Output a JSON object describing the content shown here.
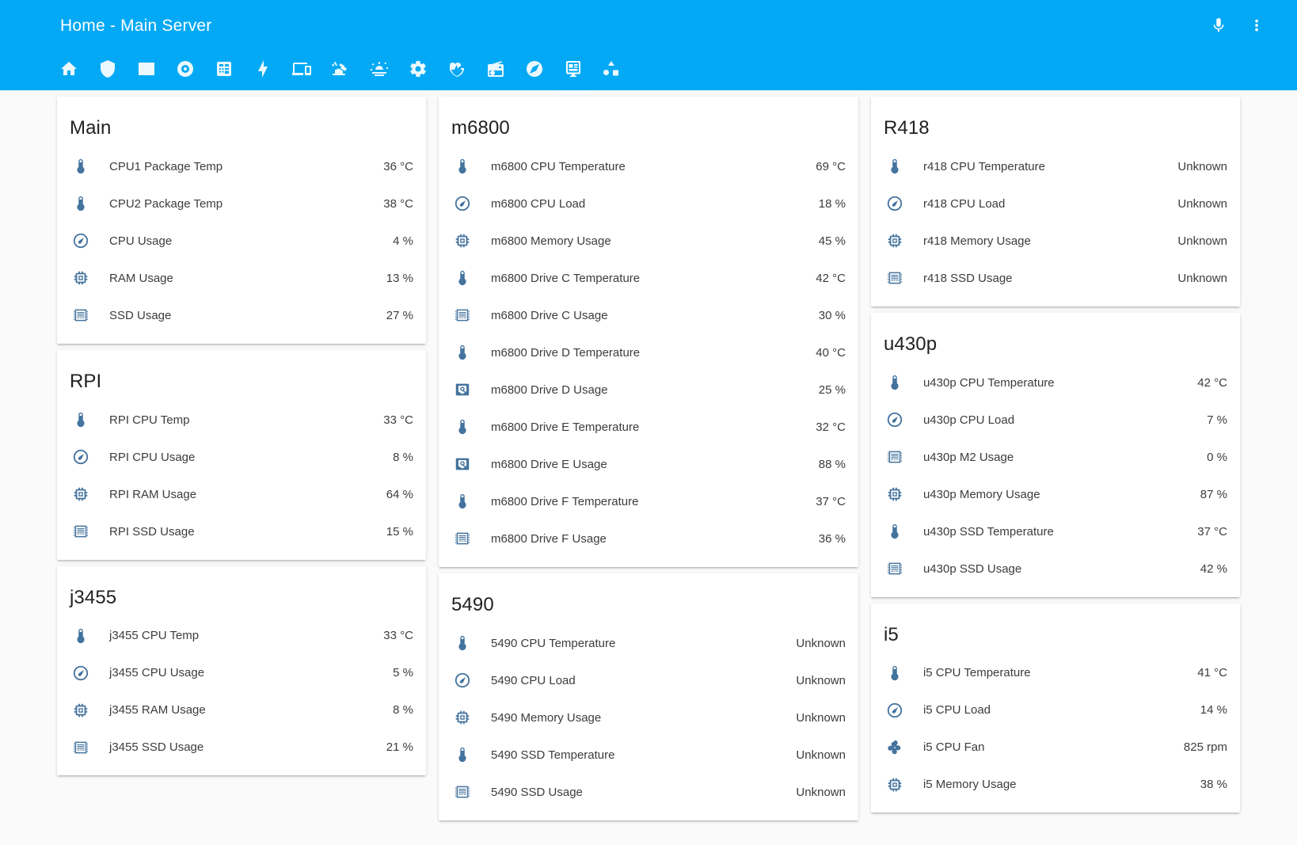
{
  "header": {
    "title": "Home - Main Server",
    "actions": [
      {
        "name": "microphone-icon",
        "label": "Assist"
      },
      {
        "name": "overflow-menu-icon",
        "label": "Menu"
      }
    ]
  },
  "tabs": [
    {
      "icon": "home-icon",
      "label": "Home",
      "active": false
    },
    {
      "icon": "shield-icon",
      "label": "Security",
      "active": false
    },
    {
      "icon": "square-icon",
      "label": "Rooms",
      "active": false
    },
    {
      "icon": "disc-icon",
      "label": "Vacuum",
      "active": false
    },
    {
      "icon": "calculator-icon",
      "label": "Meters",
      "active": false
    },
    {
      "icon": "lightning-icon",
      "label": "Energy",
      "active": false
    },
    {
      "icon": "devices-icon",
      "label": "Devices",
      "active": false
    },
    {
      "icon": "cctv-icon",
      "label": "Cameras",
      "active": false
    },
    {
      "icon": "weather-sunset-icon",
      "label": "Weather",
      "active": false
    },
    {
      "icon": "gear-icon",
      "label": "Settings",
      "active": false
    },
    {
      "icon": "heart-pulse-icon",
      "label": "Health",
      "active": false
    },
    {
      "icon": "radio-icon",
      "label": "Media",
      "active": false
    },
    {
      "icon": "compass-icon",
      "label": "Explore",
      "active": false
    },
    {
      "icon": "monitor-dashboard-icon",
      "label": "System",
      "active": true
    },
    {
      "icon": "shapes-icon",
      "label": "Misc",
      "active": false
    }
  ],
  "colors": {
    "accent": "#03a9f4",
    "icon": "#44739e",
    "text": "#3c3c3c",
    "title": "#212121",
    "card_bg": "#ffffff",
    "page_bg": "#fafafa"
  },
  "columns": [
    {
      "cards": [
        {
          "title": "Main",
          "rows": [
            {
              "icon": "thermometer-icon",
              "name": "CPU1 Package Temp",
              "value": "36 °C"
            },
            {
              "icon": "thermometer-icon",
              "name": "CPU2 Package Temp",
              "value": "38 °C"
            },
            {
              "icon": "gauge-icon",
              "name": "CPU Usage",
              "value": "4 %"
            },
            {
              "icon": "memory-icon",
              "name": "RAM Usage",
              "value": "13 %"
            },
            {
              "icon": "ssd-icon",
              "name": "SSD Usage",
              "value": "27 %"
            }
          ]
        },
        {
          "title": "RPI",
          "rows": [
            {
              "icon": "thermometer-icon",
              "name": "RPI CPU Temp",
              "value": "33 °C"
            },
            {
              "icon": "gauge-icon",
              "name": "RPI CPU Usage",
              "value": "8 %"
            },
            {
              "icon": "memory-icon",
              "name": "RPI RAM Usage",
              "value": "64 %"
            },
            {
              "icon": "ssd-icon",
              "name": "RPI SSD Usage",
              "value": "15 %"
            }
          ]
        },
        {
          "title": "j3455",
          "rows": [
            {
              "icon": "thermometer-icon",
              "name": "j3455 CPU Temp",
              "value": "33 °C"
            },
            {
              "icon": "gauge-icon",
              "name": "j3455 CPU Usage",
              "value": "5 %"
            },
            {
              "icon": "memory-icon",
              "name": "j3455 RAM Usage",
              "value": "8 %"
            },
            {
              "icon": "ssd-icon",
              "name": "j3455 SSD Usage",
              "value": "21 %"
            }
          ]
        }
      ]
    },
    {
      "cards": [
        {
          "title": "m6800",
          "rows": [
            {
              "icon": "thermometer-icon",
              "name": "m6800 CPU Temperature",
              "value": "69 °C"
            },
            {
              "icon": "gauge-icon",
              "name": "m6800 CPU Load",
              "value": "18 %"
            },
            {
              "icon": "memory-icon",
              "name": "m6800 Memory Usage",
              "value": "45 %"
            },
            {
              "icon": "thermometer-icon",
              "name": "m6800 Drive C Temperature",
              "value": "42 °C"
            },
            {
              "icon": "ssd-icon",
              "name": "m6800 Drive C Usage",
              "value": "30 %"
            },
            {
              "icon": "thermometer-icon",
              "name": "m6800 Drive D Temperature",
              "value": "40 °C"
            },
            {
              "icon": "harddisk-icon",
              "name": "m6800 Drive D Usage",
              "value": "25 %"
            },
            {
              "icon": "thermometer-icon",
              "name": "m6800 Drive E Temperature",
              "value": "32 °C"
            },
            {
              "icon": "harddisk-icon",
              "name": "m6800 Drive E Usage",
              "value": "88 %"
            },
            {
              "icon": "thermometer-icon",
              "name": "m6800 Drive F Temperature",
              "value": "37 °C"
            },
            {
              "icon": "ssd-icon",
              "name": "m6800 Drive F Usage",
              "value": "36 %"
            }
          ]
        },
        {
          "title": "5490",
          "rows": [
            {
              "icon": "thermometer-icon",
              "name": "5490 CPU Temperature",
              "value": "Unknown"
            },
            {
              "icon": "gauge-icon",
              "name": "5490 CPU Load",
              "value": "Unknown"
            },
            {
              "icon": "memory-icon",
              "name": "5490 Memory Usage",
              "value": "Unknown"
            },
            {
              "icon": "thermometer-icon",
              "name": "5490 SSD Temperature",
              "value": "Unknown"
            },
            {
              "icon": "ssd-icon",
              "name": "5490 SSD Usage",
              "value": "Unknown"
            }
          ]
        }
      ]
    },
    {
      "cards": [
        {
          "title": "R418",
          "rows": [
            {
              "icon": "thermometer-icon",
              "name": "r418 CPU Temperature",
              "value": "Unknown"
            },
            {
              "icon": "gauge-icon",
              "name": "r418 CPU Load",
              "value": "Unknown"
            },
            {
              "icon": "memory-icon",
              "name": "r418 Memory Usage",
              "value": "Unknown"
            },
            {
              "icon": "ssd-icon",
              "name": "r418 SSD Usage",
              "value": "Unknown"
            }
          ]
        },
        {
          "title": "u430p",
          "rows": [
            {
              "icon": "thermometer-icon",
              "name": "u430p CPU Temperature",
              "value": "42 °C"
            },
            {
              "icon": "gauge-icon",
              "name": "u430p CPU Load",
              "value": "7 %"
            },
            {
              "icon": "ssd-icon",
              "name": "u430p M2 Usage",
              "value": "0 %"
            },
            {
              "icon": "memory-icon",
              "name": "u430p Memory Usage",
              "value": "87 %"
            },
            {
              "icon": "thermometer-icon",
              "name": "u430p SSD Temperature",
              "value": "37 °C"
            },
            {
              "icon": "ssd-icon",
              "name": "u430p SSD Usage",
              "value": "42 %"
            }
          ]
        },
        {
          "title": "i5",
          "rows": [
            {
              "icon": "thermometer-icon",
              "name": "i5 CPU Temperature",
              "value": "41 °C"
            },
            {
              "icon": "gauge-icon",
              "name": "i5 CPU Load",
              "value": "14 %"
            },
            {
              "icon": "fan-icon",
              "name": "i5 CPU Fan",
              "value": "825 rpm"
            },
            {
              "icon": "memory-icon",
              "name": "i5 Memory Usage",
              "value": "38 %"
            }
          ]
        }
      ]
    }
  ]
}
